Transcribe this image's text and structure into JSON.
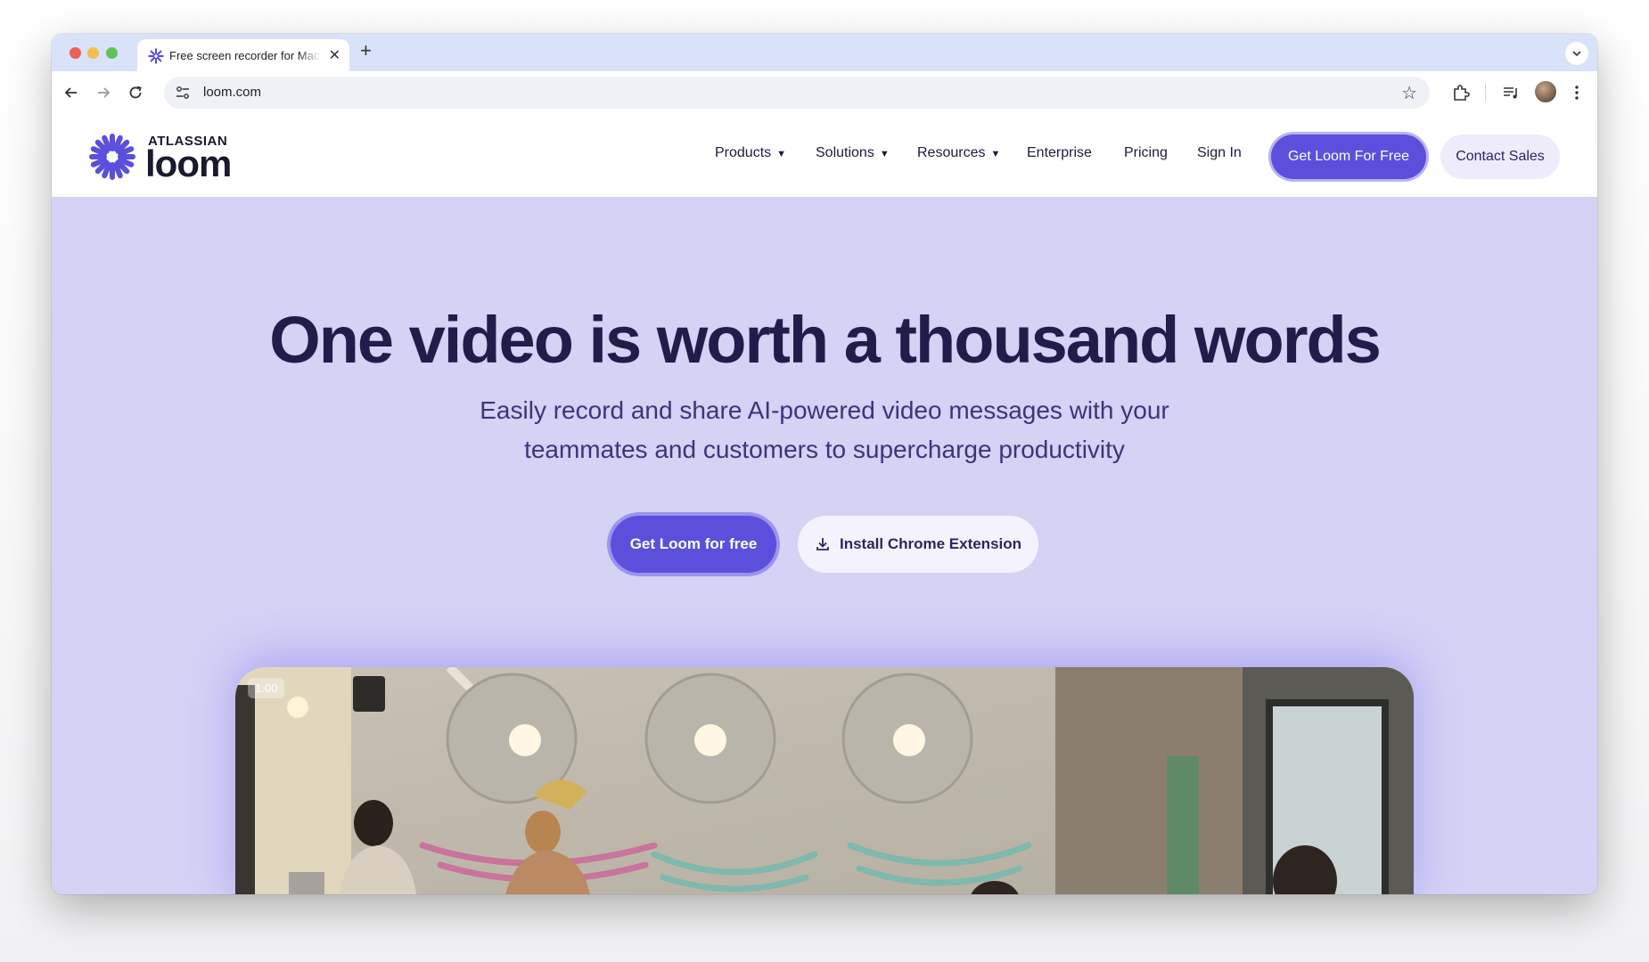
{
  "browser": {
    "tab": {
      "title": "Free screen recorder for Mac"
    },
    "address": {
      "url": "loom.com"
    }
  },
  "site": {
    "logo": {
      "superscript": "ATLASSIAN",
      "wordmark": "loom"
    },
    "nav": {
      "items": [
        {
          "label": "Products"
        },
        {
          "label": "Solutions"
        },
        {
          "label": "Resources"
        },
        {
          "label": "Enterprise"
        },
        {
          "label": "Pricing"
        },
        {
          "label": "Sign In"
        }
      ],
      "cta_label": "Get Loom For Free",
      "contact_label": "Contact Sales"
    },
    "hero": {
      "title": "One video is worth a thousand words",
      "subtitle_line1": "Easily record and share AI-powered video messages with your",
      "subtitle_line2": "teammates and customers to supercharge productivity",
      "primary_button": "Get Loom for free",
      "secondary_button": "Install Chrome Extension",
      "video_speed": "1.00"
    }
  },
  "colors": {
    "brand": "#5b4fdc",
    "hero_bg": "#d4d2f5",
    "heading": "#221c4a"
  }
}
